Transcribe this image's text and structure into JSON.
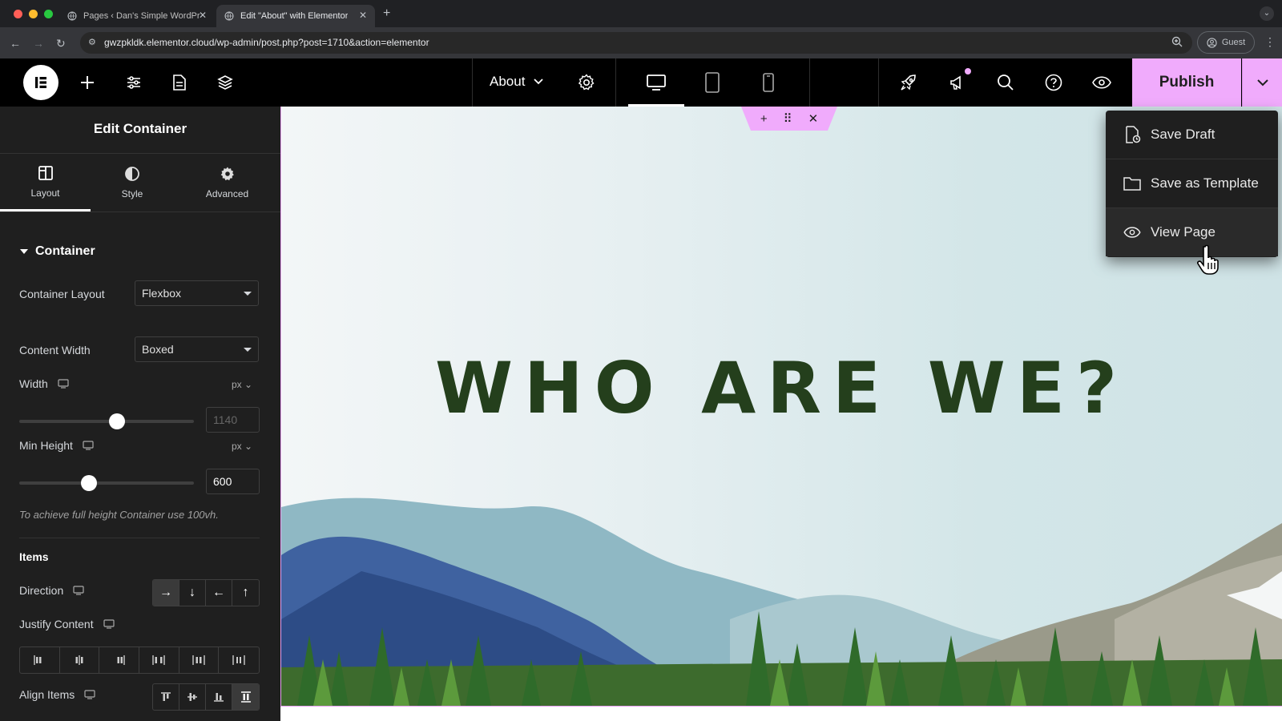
{
  "browser": {
    "tabs": [
      {
        "title": "Pages ‹ Dan's Simple WordPr",
        "active": false
      },
      {
        "title": "Edit \"About\" with Elementor",
        "active": true
      }
    ],
    "url": "gwzpkldk.elementor.cloud/wp-admin/post.php?post=1710&action=elementor",
    "profile_label": "Guest"
  },
  "topbar": {
    "page_name": "About",
    "publish_label": "Publish",
    "accent_color": "#f0abfc",
    "icons": [
      "add-icon",
      "site-settings-icon",
      "page-icon",
      "layers-icon",
      "gear-icon",
      "desktop-icon",
      "tablet-icon",
      "mobile-icon",
      "rocket-icon",
      "megaphone-icon",
      "search-icon",
      "help-icon",
      "eye-icon",
      "chevron-down-icon"
    ]
  },
  "panel": {
    "title": "Edit Container",
    "tabs": [
      {
        "label": "Layout",
        "icon": "layout-icon",
        "active": true
      },
      {
        "label": "Style",
        "icon": "style-icon",
        "active": false
      },
      {
        "label": "Advanced",
        "icon": "gear-icon",
        "active": false
      }
    ],
    "section_title": "Container",
    "container_layout": {
      "label": "Container Layout",
      "value": "Flexbox"
    },
    "content_width": {
      "label": "Content Width",
      "value": "Boxed"
    },
    "width": {
      "label": "Width",
      "unit": "px",
      "placeholder": "1140",
      "slider_fraction": 0.56
    },
    "min_height": {
      "label": "Min Height",
      "unit": "px",
      "value": "600",
      "slider_fraction": 0.4
    },
    "hint": "To achieve full height Container use 100vh.",
    "items_title": "Items",
    "direction": {
      "label": "Direction",
      "options": [
        "→",
        "↓",
        "←",
        "↑"
      ],
      "selected": 0
    },
    "justify_content": {
      "label": "Justify Content"
    },
    "align_items": {
      "label": "Align Items",
      "selected": 3
    }
  },
  "canvas": {
    "heading": "WHO ARE WE?",
    "heading_color": "#243f1c"
  },
  "publish_menu": {
    "items": [
      {
        "label": "Save Draft",
        "icon": "save-draft-icon"
      },
      {
        "label": "Save as Template",
        "icon": "folder-icon"
      },
      {
        "label": "View Page",
        "icon": "eye-icon",
        "hovered": true
      }
    ]
  }
}
